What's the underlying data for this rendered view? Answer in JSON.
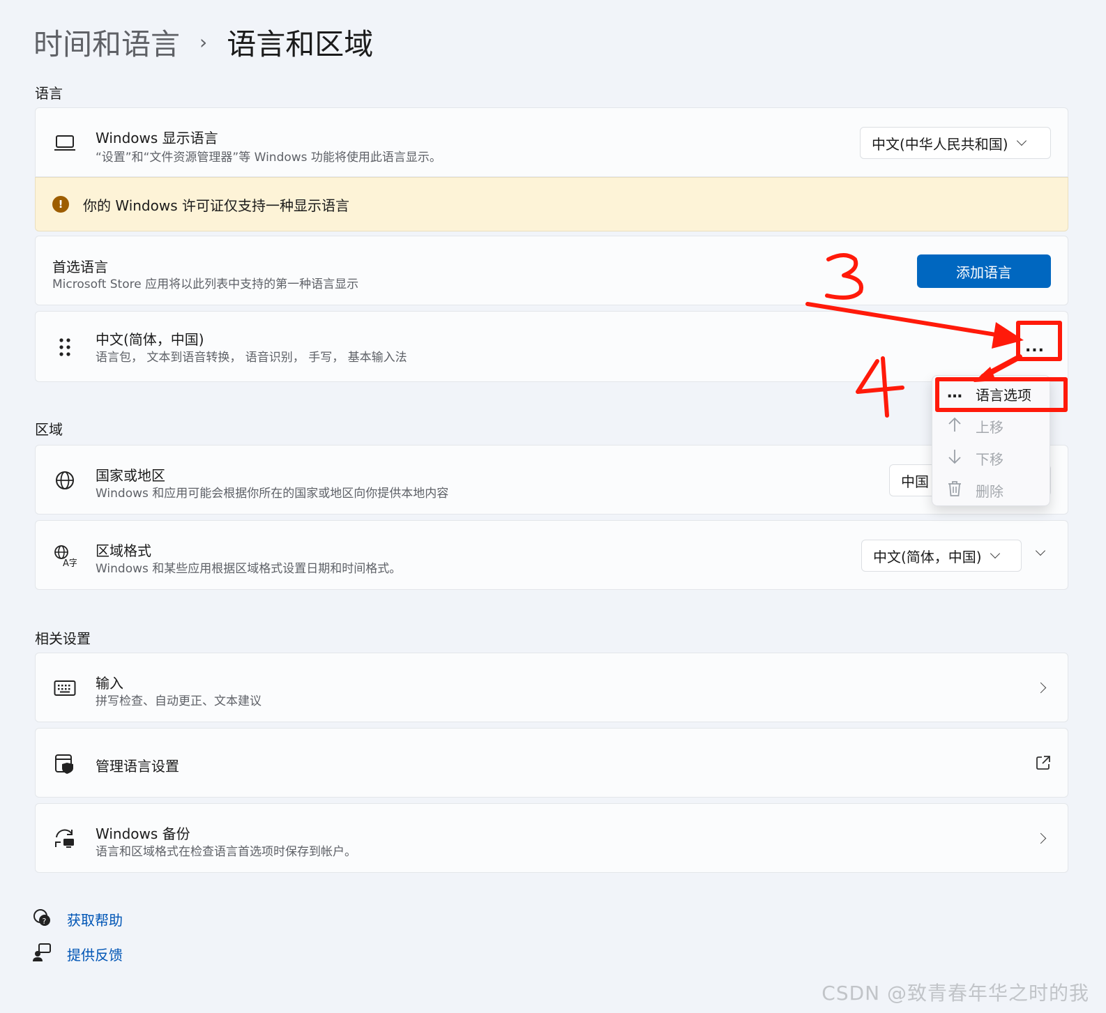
{
  "breadcrumb": {
    "parent": "时间和语言",
    "separator": "›",
    "current": "语言和区域"
  },
  "sections": {
    "language": "语言",
    "region": "区域",
    "related": "相关设置"
  },
  "display_language": {
    "title": "Windows 显示语言",
    "desc": "“设置”和“文件资源管理器”等 Windows 功能将使用此语言显示。",
    "value": "中文(中华人民共和国)"
  },
  "warning": {
    "text": "你的 Windows 许可证仅支持一种显示语言",
    "icon": "!"
  },
  "preferred": {
    "title": "首选语言",
    "desc": "Microsoft Store 应用将以此列表中支持的第一种语言显示",
    "add_button": "添加语言"
  },
  "language_item": {
    "title": "中文(简体，中国)",
    "desc": "语言包，  文本到语音转换，  语音识别，  手写，  基本输入法",
    "more": "..."
  },
  "context_menu": {
    "items": [
      {
        "label": "语言选项",
        "icon": "…"
      },
      {
        "label": "上移",
        "icon": "arrow-up-icon"
      },
      {
        "label": "下移",
        "icon": "arrow-down-icon"
      },
      {
        "label": "删除",
        "icon": "trash-icon"
      }
    ]
  },
  "country": {
    "title": "国家或地区",
    "desc": "Windows 和应用可能会根据你所在的国家或地区向你提供本地内容",
    "value": "中国"
  },
  "regional_format": {
    "title": "区域格式",
    "desc": "Windows 和某些应用根据区域格式设置日期和时间格式。",
    "value": "中文(简体，中国)"
  },
  "input": {
    "title": "输入",
    "desc": "拼写检查、自动更正、文本建议"
  },
  "admin_language": {
    "title": "管理语言设置"
  },
  "backup": {
    "title": "Windows 备份",
    "desc": "语言和区域格式在检查语言首选项时保存到帐户。"
  },
  "footer": {
    "help": "获取帮助",
    "feedback": "提供反馈"
  },
  "annotations": {
    "step3": "3",
    "step4": "4",
    "color": "#ff1a0a"
  },
  "watermark": "CSDN @致青春年华之时的我",
  "colors": {
    "accent": "#0067c0",
    "warning_bg": "#fdf3d7",
    "link": "#0055b5"
  }
}
